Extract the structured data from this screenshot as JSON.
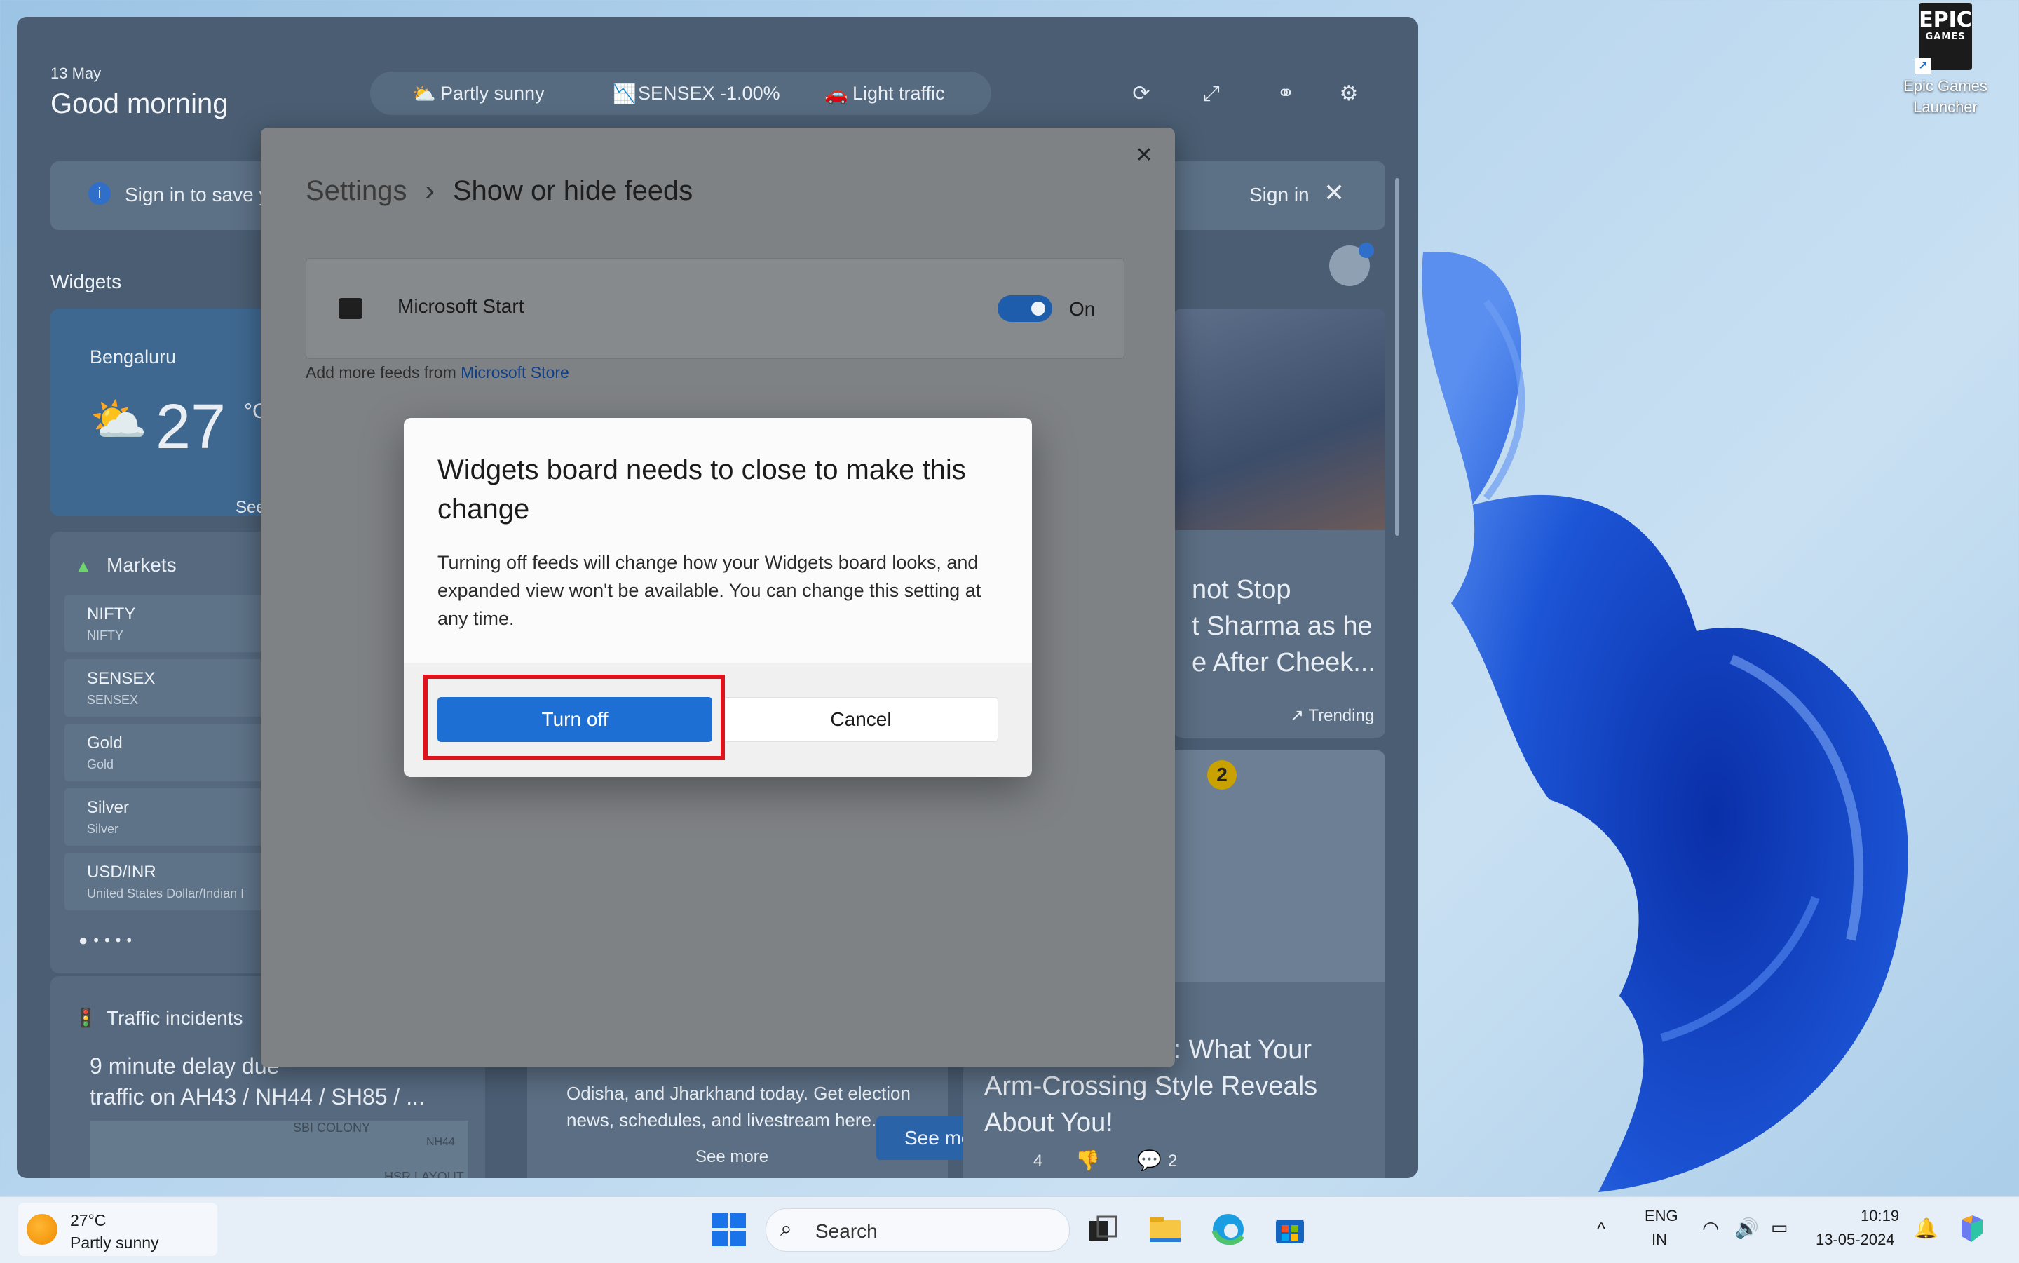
{
  "desktop": {
    "icons": [
      {
        "label": "Epic Games Launcher",
        "logo_text": "EPIC",
        "logo_sub": "GAMES"
      }
    ]
  },
  "board": {
    "date": "13 May",
    "greeting": "Good morning",
    "status": {
      "weather": "Partly sunny",
      "market": "SENSEX -1.00%",
      "traffic": "Light traffic"
    },
    "signin_bar": {
      "text": "Sign in to save yo",
      "action": "Sign in"
    },
    "widgets_label": "Widgets",
    "weather_widget": {
      "city": "Bengaluru",
      "temp": "27",
      "unit": "°C",
      "link": "See full"
    },
    "markets": {
      "title": "Markets",
      "rows": [
        {
          "name": "NIFTY",
          "sub": "NIFTY"
        },
        {
          "name": "SENSEX",
          "sub": "SENSEX"
        },
        {
          "name": "Gold",
          "sub": "Gold"
        },
        {
          "name": "Silver",
          "sub": "Silver"
        },
        {
          "name": "USD/INR",
          "sub": "United States Dollar/Indian I"
        }
      ]
    },
    "traffic": {
      "title": "Traffic incidents",
      "headline": "9 minute delay due",
      "headline2": "traffic on AH43 / NH44 / SH85 / ...",
      "map_labels": [
        "SBI COLONY",
        "NH44",
        "HSR LAYOUT"
      ]
    },
    "news1": {
      "line1": "not Stop",
      "line2": "t Sharma as he",
      "line3": "e After Cheek...",
      "badge": "Trending"
    },
    "news2": {
      "line1": "t: What Your",
      "line2": "Arm-Crossing Style Reveals",
      "line3": "About You!",
      "reactions": "4",
      "comments": "2",
      "rank": "2"
    },
    "mid_card": {
      "line1": "Odisha, and Jharkhand today. Get election",
      "line2": "news, schedules, and livestream here.",
      "link": "See more",
      "button": "See more"
    }
  },
  "settings": {
    "breadcrumb_root": "Settings",
    "breadcrumb_page": "Show or hide feeds",
    "feed": {
      "name": "Microsoft Start",
      "state": "On"
    },
    "add_more_prefix": "Add more feeds from ",
    "add_more_link": "Microsoft Store"
  },
  "dialog": {
    "title": "Widgets board needs to close to make this change",
    "body": "Turning off feeds will change how your Widgets board looks, and expanded view won't be available. You can change this setting at any time.",
    "primary": "Turn off",
    "secondary": "Cancel"
  },
  "taskbar": {
    "weather_temp": "27°C",
    "weather_cond": "Partly sunny",
    "search_placeholder": "Search",
    "lang1": "ENG",
    "lang2": "IN",
    "time": "10:19",
    "date": "13-05-2024"
  },
  "colors": {
    "accent": "#1e6fd3",
    "highlight": "#e0121b"
  }
}
